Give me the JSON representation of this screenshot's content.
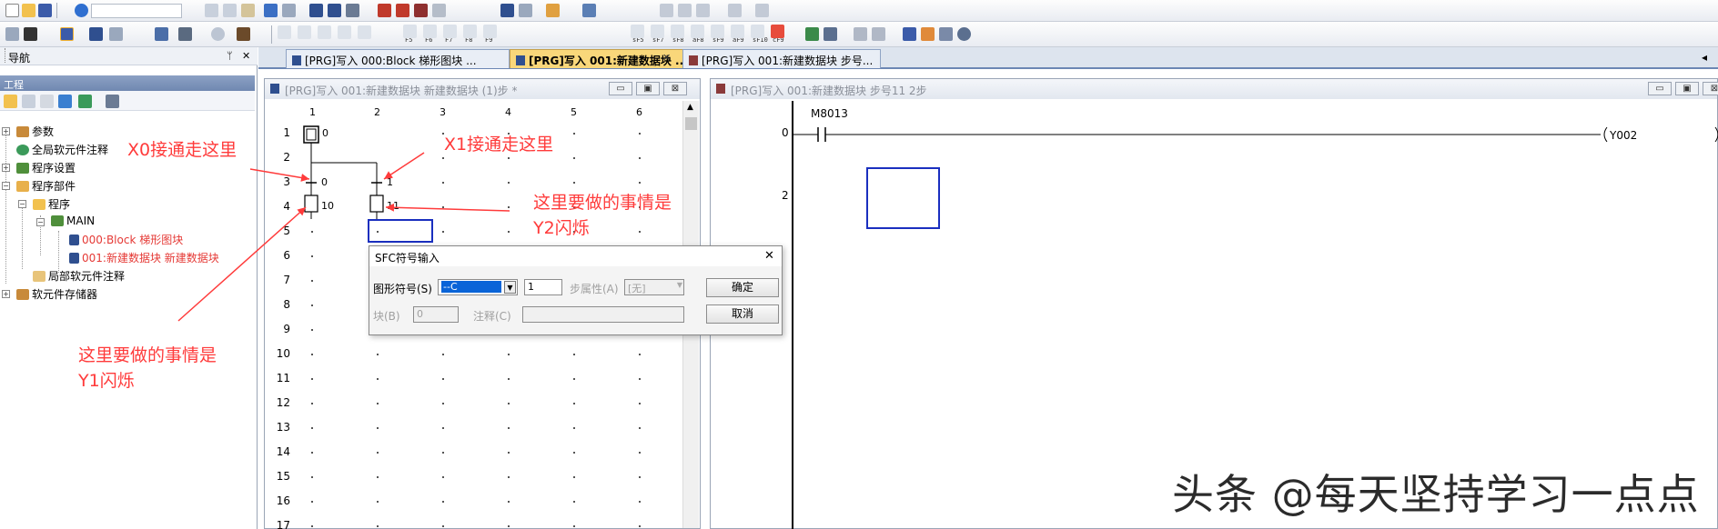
{
  "toolbar": {
    "row2_keys": [
      "F5",
      "F6",
      "F7",
      "F8",
      "F9",
      "sF5",
      "sF7",
      "sF8",
      "aF8",
      "sF9",
      "aF9",
      "sF10",
      "cF9"
    ]
  },
  "navigator": {
    "title": "导航",
    "pin": "ᛘ",
    "close": "✕",
    "project_label": "工程",
    "tree": [
      {
        "label": "参数"
      },
      {
        "label": "全局软元件注释"
      },
      {
        "label": "程序设置"
      },
      {
        "label": "程序部件"
      },
      {
        "label": "程序"
      },
      {
        "label": "MAIN"
      },
      {
        "label": "000:Block 梯形图块"
      },
      {
        "label": "001:新建数据块 新建数据块"
      },
      {
        "label": "局部软元件注释"
      },
      {
        "label": "软元件存储器"
      }
    ]
  },
  "tabs": [
    {
      "label": "[PRG]写入 000:Block 梯形图块 ..."
    },
    {
      "label": "[PRG]写入 001:新建数据块 ..."
    },
    {
      "label": "[PRG]写入 001:新建数据块 步号..."
    }
  ],
  "tab_close": "✕",
  "tab_arrow": "◂",
  "sfc_window": {
    "title": "[PRG]写入 001:新建数据块 新建数据块 (1)步 *",
    "columns": [
      "1",
      "2",
      "3",
      "4",
      "5",
      "6"
    ],
    "rows": [
      "1",
      "2",
      "3",
      "4",
      "5",
      "6",
      "7",
      "8",
      "9",
      "10",
      "11",
      "12",
      "13",
      "14",
      "15",
      "16",
      "17"
    ],
    "nodes": {
      "initial_step": "0",
      "transition_left": "0",
      "transition_right": "1",
      "step_left": "10",
      "step_right": "11"
    }
  },
  "ladder_window": {
    "title": "[PRG]写入 001:新建数据块 步号11 2步",
    "contact_label": "M8013",
    "step0": "0",
    "step2": "2",
    "coil_label": "Y002"
  },
  "window_buttons": {
    "min": "▭",
    "max": "▣",
    "close": "⊠"
  },
  "annotations": {
    "x0": "X0接通走这里",
    "x1": "X1接通走这里",
    "y2_line1": "这里要做的事情是",
    "y2_line2": "Y2闪烁",
    "y1_line1": "这里要做的事情是",
    "y1_line2": "Y1闪烁"
  },
  "dialog": {
    "title": "SFC符号输入",
    "close": "✕",
    "symbol_label": "图形符号(S)",
    "symbol_value": "--C",
    "number_value": "1",
    "step_attr_label": "步属性(A)",
    "step_attr_value": "[无]",
    "block_label": "块(B)",
    "block_value": "0",
    "comment_label": "注释(C)",
    "comment_value": "",
    "ok_label": "确定",
    "cancel_label": "取消"
  },
  "watermark": "头条 @每天坚持学习一点点"
}
